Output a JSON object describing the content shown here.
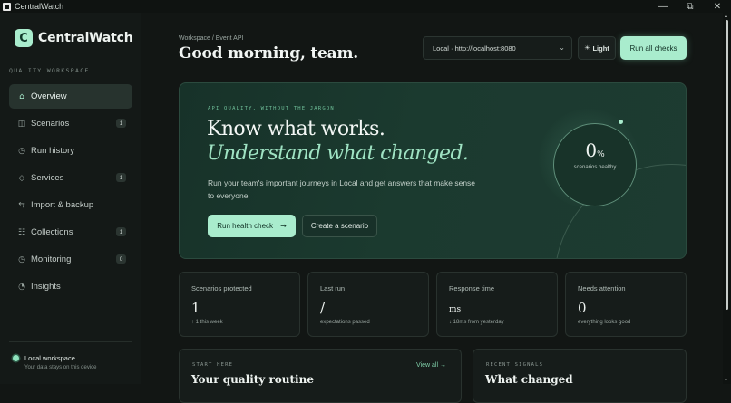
{
  "window": {
    "title": "CentralWatch",
    "minimize_glyph": "—",
    "maximize_glyph": "⧉",
    "close_glyph": "✕"
  },
  "sidebar": {
    "brand_letter": "C",
    "brand_name": "CentralWatch",
    "section_label": "QUALITY WORKSPACE",
    "items": [
      {
        "label": "Overview",
        "icon": "home-icon",
        "glyph": "⌂",
        "badge": ""
      },
      {
        "label": "Scenarios",
        "icon": "grid-icon",
        "glyph": "◫",
        "badge": "1"
      },
      {
        "label": "Run history",
        "icon": "clock-icon",
        "glyph": "◷",
        "badge": ""
      },
      {
        "label": "Services",
        "icon": "diamond-icon",
        "glyph": "◇",
        "badge": "1"
      },
      {
        "label": "Import & backup",
        "icon": "transfer-icon",
        "glyph": "⇆",
        "badge": ""
      },
      {
        "label": "Collections",
        "icon": "list-icon",
        "glyph": "☷",
        "badge": "1"
      },
      {
        "label": "Monitoring",
        "icon": "monitor-icon",
        "glyph": "◷",
        "badge": "0"
      },
      {
        "label": "Insights",
        "icon": "pie-icon",
        "glyph": "◔",
        "badge": ""
      }
    ],
    "local": {
      "title": "Local workspace",
      "subtitle": "Your data stays on this device"
    }
  },
  "header": {
    "breadcrumb": "Workspace / Event API",
    "greeting": "Good morning, team.",
    "environment": "Local · http://localhost:8080",
    "theme_label": "Light",
    "theme_glyph": "☀",
    "run_all_label": "Run all checks"
  },
  "hero": {
    "eyebrow": "API QUALITY, WITHOUT THE JARGON",
    "headline": "Know what works.",
    "headline_accent": "Understand what changed.",
    "description": "Run your team's important journeys in Local and get answers that make sense to everyone.",
    "primary_label": "Run health check",
    "primary_arrow": "→",
    "secondary_label": "Create a scenario",
    "health_value": "0",
    "health_unit": "%",
    "health_label": "scenarios healthy"
  },
  "stats": [
    {
      "label": "Scenarios protected",
      "value": "1",
      "note": "↑ 1 this week"
    },
    {
      "label": "Last run",
      "value": "/",
      "note": "expectations passed"
    },
    {
      "label": "Response time",
      "value": "ms",
      "note": "↓ 18ms from yesterday"
    },
    {
      "label": "Needs attention",
      "value": "0",
      "note": "everything looks good"
    }
  ],
  "panels": {
    "routine": {
      "eyebrow": "START HERE",
      "title": "Your quality routine",
      "link": "View all →"
    },
    "signals": {
      "eyebrow": "RECENT SIGNALS",
      "title": "What changed"
    }
  },
  "colors": {
    "accent": "#a9eccd",
    "background": "#121614",
    "hero": "#1b3a2f"
  }
}
